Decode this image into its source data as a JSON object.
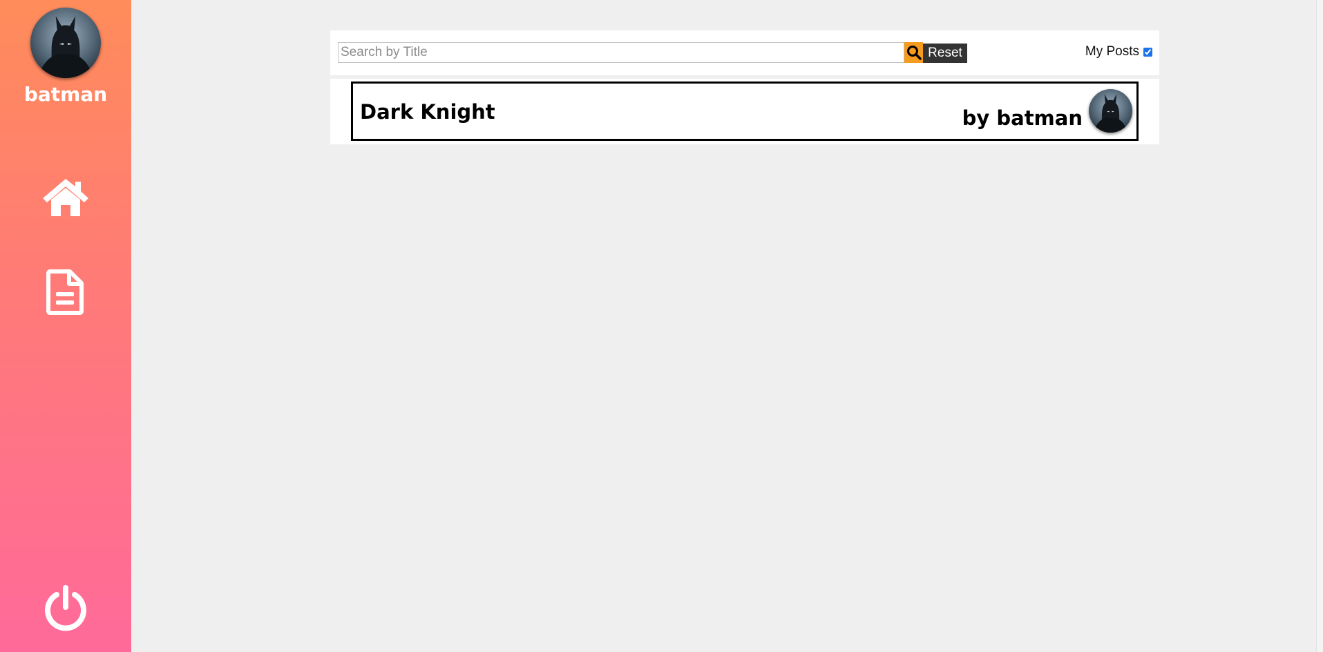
{
  "sidebar": {
    "username": "batman",
    "nav": [
      {
        "icon": "home-icon"
      },
      {
        "icon": "document-icon"
      }
    ],
    "logout_icon": "power-icon"
  },
  "toolbar": {
    "search_placeholder": "Search by Title",
    "search_value": "",
    "search_icon": "search-icon",
    "reset_label": "Reset",
    "my_posts_label": "My Posts",
    "my_posts_checked": true
  },
  "posts": [
    {
      "title": "Dark Knight",
      "author_text": "by batman"
    }
  ],
  "colors": {
    "sidebar_gradient_top": "#ff8c5a",
    "sidebar_gradient_bottom": "#ff6a9a",
    "search_button": "#f59b1e",
    "reset_button": "#333333",
    "background": "#efefef"
  }
}
